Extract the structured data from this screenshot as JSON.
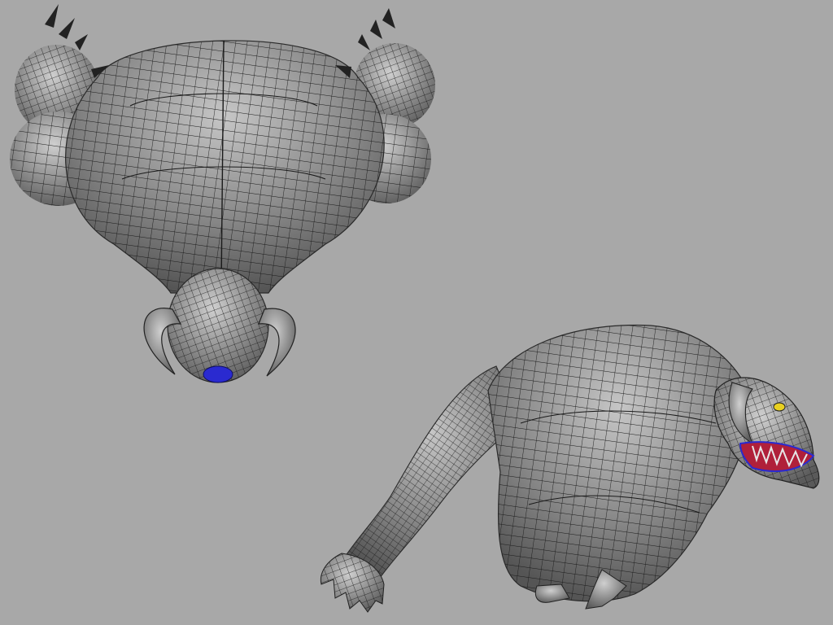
{
  "viewport": {
    "background_color": "#a8a8a8",
    "mesh_fill_color": "#8a8a8a",
    "mesh_highlight_color": "#c4c4c4",
    "wire_color": "#1a1a1a",
    "accent_blue": "#2a2ad0",
    "mouth_red": "#b0203a",
    "eye_yellow": "#e8d020"
  },
  "models": [
    {
      "name": "creature-top-view",
      "view": "top"
    },
    {
      "name": "creature-perspective-view",
      "view": "perspective"
    }
  ]
}
